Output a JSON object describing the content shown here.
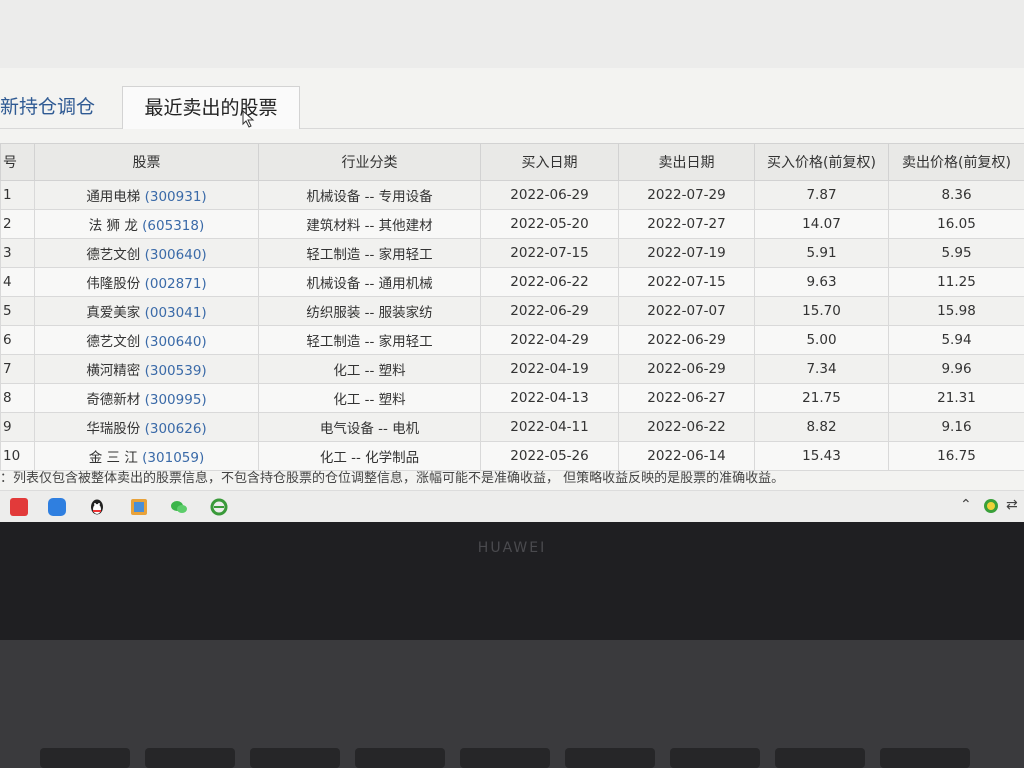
{
  "tabs": [
    {
      "label": "新持仓调仓"
    },
    {
      "label": "最近卖出的股票"
    }
  ],
  "table": {
    "headers": [
      "号",
      "股票",
      "行业分类",
      "买入日期",
      "卖出日期",
      "买入价格(前复权)",
      "卖出价格(前复权)"
    ],
    "rows": [
      {
        "idx": "1",
        "name": "通用电梯",
        "code": "(300931)",
        "industry": "机械设备 -- 专用设备",
        "buy_date": "2022-06-29",
        "sell_date": "2022-07-29",
        "buy_price": "7.87",
        "sell_price": "8.36"
      },
      {
        "idx": "2",
        "name": "法 狮 龙",
        "code": "(605318)",
        "industry": "建筑材料 -- 其他建材",
        "buy_date": "2022-05-20",
        "sell_date": "2022-07-27",
        "buy_price": "14.07",
        "sell_price": "16.05"
      },
      {
        "idx": "3",
        "name": "德艺文创",
        "code": "(300640)",
        "industry": "轻工制造 -- 家用轻工",
        "buy_date": "2022-07-15",
        "sell_date": "2022-07-19",
        "buy_price": "5.91",
        "sell_price": "5.95"
      },
      {
        "idx": "4",
        "name": "伟隆股份",
        "code": "(002871)",
        "industry": "机械设备 -- 通用机械",
        "buy_date": "2022-06-22",
        "sell_date": "2022-07-15",
        "buy_price": "9.63",
        "sell_price": "11.25"
      },
      {
        "idx": "5",
        "name": "真爱美家",
        "code": "(003041)",
        "industry": "纺织服装 -- 服装家纺",
        "buy_date": "2022-06-29",
        "sell_date": "2022-07-07",
        "buy_price": "15.70",
        "sell_price": "15.98"
      },
      {
        "idx": "6",
        "name": "德艺文创",
        "code": "(300640)",
        "industry": "轻工制造 -- 家用轻工",
        "buy_date": "2022-04-29",
        "sell_date": "2022-06-29",
        "buy_price": "5.00",
        "sell_price": "5.94"
      },
      {
        "idx": "7",
        "name": "横河精密",
        "code": "(300539)",
        "industry": "化工 -- 塑料",
        "buy_date": "2022-04-19",
        "sell_date": "2022-06-29",
        "buy_price": "7.34",
        "sell_price": "9.96"
      },
      {
        "idx": "8",
        "name": "奇德新材",
        "code": "(300995)",
        "industry": "化工 -- 塑料",
        "buy_date": "2022-04-13",
        "sell_date": "2022-06-27",
        "buy_price": "21.75",
        "sell_price": "21.31"
      },
      {
        "idx": "9",
        "name": "华瑞股份",
        "code": "(300626)",
        "industry": "电气设备 -- 电机",
        "buy_date": "2022-04-11",
        "sell_date": "2022-06-22",
        "buy_price": "8.82",
        "sell_price": "9.16"
      },
      {
        "idx": "10",
        "name": "金 三 江",
        "code": "(301059)",
        "industry": "化工 -- 化学制品",
        "buy_date": "2022-05-26",
        "sell_date": "2022-06-14",
        "buy_price": "15.43",
        "sell_price": "16.75"
      }
    ]
  },
  "note": "：列表仅包含被整体卖出的股票信息，不包含持仓股票的仓位调整信息，涨幅可能不是准确收益， 但策略收益反映的是股票的准确收益。",
  "taskbar": {
    "icons": [
      "app-red-icon",
      "cloud-icon",
      "qq-penguin-icon",
      "photo-app-icon",
      "wechat-icon",
      "ie-browser-icon"
    ],
    "tray": [
      "chevron-up-icon",
      "security-shield-icon",
      "network-icon"
    ],
    "colors": {
      "app-red": "#e23a3a",
      "cloud": "#2f7fe0",
      "wechat": "#3bb54a",
      "ie": "#3a9a3a",
      "photo": "#e8a23a"
    }
  },
  "device": {
    "brand": "HUAWEI"
  }
}
